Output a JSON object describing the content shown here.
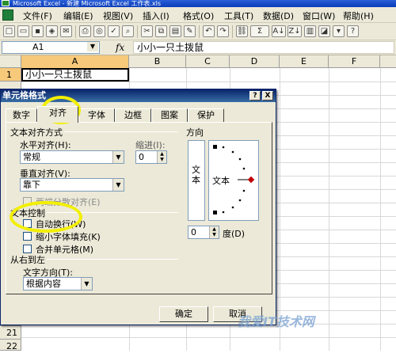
{
  "window": {
    "title": "Microsoft Excel - 新建 Microsoft Excel 工作表.xls"
  },
  "menu": [
    "文件(F)",
    "编辑(E)",
    "视图(V)",
    "插入(I)",
    "格式(O)",
    "工具(T)",
    "数据(D)",
    "窗口(W)",
    "帮助(H)"
  ],
  "toolbar": {
    "sigma": "Σ",
    "sort_az": "A↓",
    "sort_za": "Z↓"
  },
  "formula_bar": {
    "name_box": "A1",
    "fx": "fx",
    "value": "小小一只土拨鼠"
  },
  "grid": {
    "columns": [
      "A",
      "B",
      "C",
      "D",
      "E",
      "F"
    ],
    "rows": [
      "1",
      "21",
      "22"
    ],
    "a1_value": "小小一只土拨鼠"
  },
  "dialog": {
    "title": "单元格格式",
    "help": "?",
    "close": "X",
    "tabs": [
      "数字",
      "对齐",
      "字体",
      "边框",
      "图案",
      "保护"
    ],
    "active_tab": "对齐",
    "text_alignment": {
      "group_label": "文本对齐方式",
      "horizontal_label": "水平对齐(H):",
      "horizontal_value": "常规",
      "indent_label": "缩进(I):",
      "indent_value": "0",
      "vertical_label": "垂直对齐(V):",
      "vertical_value": "靠下",
      "justify_distributed": "两端分散对齐(E)"
    },
    "text_control": {
      "group_label": "文本控制",
      "wrap": "自动换行(W)",
      "shrink": "缩小字体填充(K)",
      "merge": "合并单元格(M)"
    },
    "rtl": {
      "group_label": "从右到左",
      "direction_label": "文字方向(T):",
      "direction_value": "根据内容"
    },
    "orientation": {
      "group_label": "方向",
      "vertical_text": "文本",
      "dial_text": "文本",
      "degrees_value": "0",
      "degrees_label": "度(D)"
    },
    "ok": "确定",
    "cancel": "取消"
  },
  "watermark": "我爱IT技术网"
}
